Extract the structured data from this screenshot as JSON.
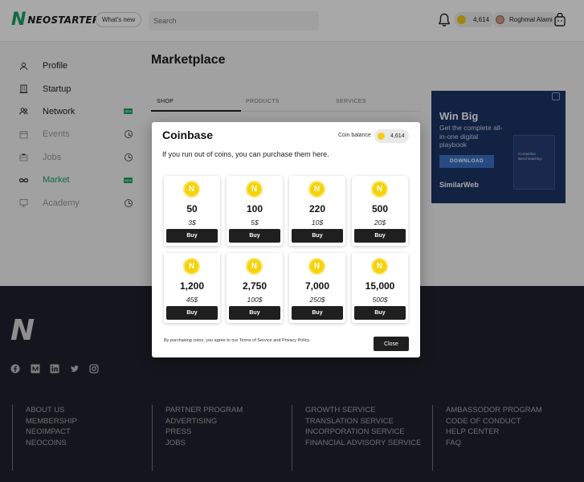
{
  "header": {
    "logo_mark": "N",
    "logo_text": "NEOSTARTER",
    "whats_new": "What's new",
    "search_placeholder": "Search",
    "coins": "4,614",
    "user_name": "Roghmal Alami"
  },
  "sidebar": {
    "items": [
      {
        "label": "Profile",
        "icon": "user-icon",
        "state": "normal"
      },
      {
        "label": "Startup",
        "icon": "building-icon",
        "state": "normal"
      },
      {
        "label": "Network",
        "icon": "users-icon",
        "state": "normal",
        "badge": "NEW"
      },
      {
        "label": "Events",
        "icon": "calendar-icon",
        "state": "locked"
      },
      {
        "label": "Jobs",
        "icon": "briefcase-icon",
        "state": "locked"
      },
      {
        "label": "Market",
        "icon": "infinity-icon",
        "state": "active",
        "badge": "NEW"
      },
      {
        "label": "Academy",
        "icon": "screen-icon",
        "state": "locked"
      }
    ]
  },
  "main": {
    "title": "Marketplace",
    "tabs": [
      "SHOP",
      "PRODUCTS",
      "SERVICES"
    ],
    "active_tab": "SHOP"
  },
  "ad": {
    "title": "Win Big",
    "subtitle": "Get the complete all-in-one digital playbook",
    "button": "DOWNLOAD",
    "book_text": "Competitor Benchmarking:",
    "brand": "SimilarWeb"
  },
  "modal": {
    "title": "Coinbase",
    "balance_label": "Coin balance",
    "balance": "4,614",
    "description": "If you run out of coins, you can purchase them here.",
    "coin_glyph": "N",
    "buy_label": "Buy",
    "packs": [
      {
        "amount": "50",
        "price": "3$"
      },
      {
        "amount": "100",
        "price": "5$"
      },
      {
        "amount": "220",
        "price": "10$"
      },
      {
        "amount": "500",
        "price": "20$"
      },
      {
        "amount": "1,200",
        "price": "45$"
      },
      {
        "amount": "2,750",
        "price": "100$"
      },
      {
        "amount": "7,000",
        "price": "250$"
      },
      {
        "amount": "15,000",
        "price": "500$"
      }
    ],
    "terms": "By purchasing coins, you agree to our Terms of Service and Privacy Policy.",
    "close_label": "Close"
  },
  "footer": {
    "logo_mark": "N",
    "social": [
      "facebook-icon",
      "medium-icon",
      "linkedin-icon",
      "twitter-icon",
      "instagram-icon"
    ],
    "columns": [
      [
        "ABOUT US",
        "MEMBERSHIP",
        "NEOIMPACT",
        "NEOCOINS"
      ],
      [
        "PARTNER PROGRAM",
        "ADVERTISING",
        "PRESS",
        "JOBS"
      ],
      [
        "GROWTH SERVICE",
        "TRANSLATION SERVICE",
        "INCORPORATION SERVICE",
        "FINANCIAL ADVISORY SERVICE"
      ],
      [
        "AMBASSODOR PROGRAM",
        "CODE OF CONDUCT",
        "HELP CENTER",
        "FAQ"
      ]
    ]
  }
}
